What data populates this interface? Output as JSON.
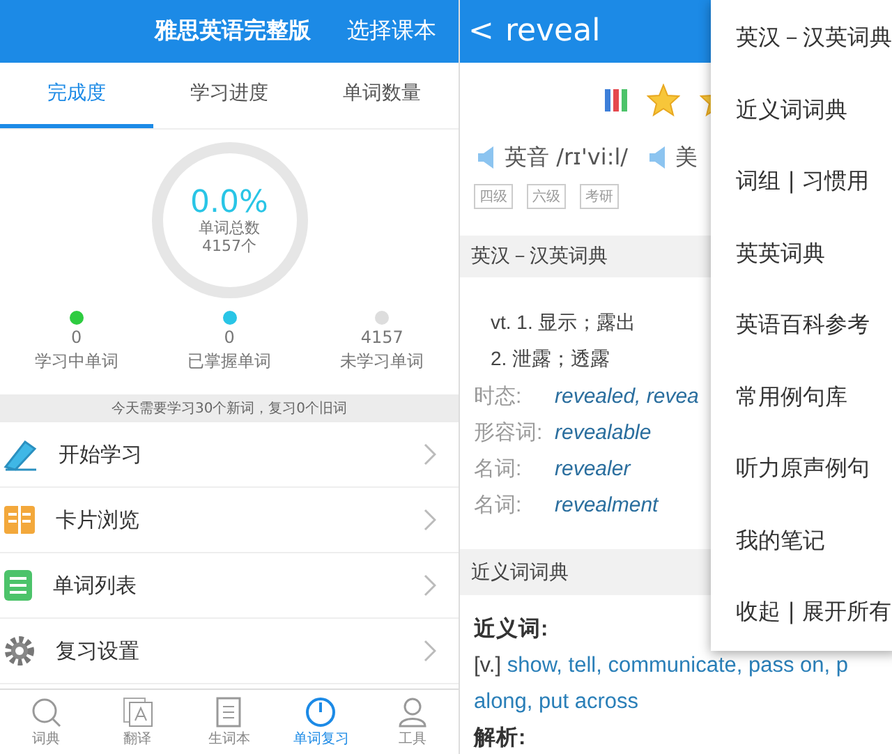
{
  "left": {
    "header": {
      "title": "雅思英语完整版",
      "action": "选择课本"
    },
    "tabs": [
      {
        "label": "完成度",
        "selected": true
      },
      {
        "label": "学习进度",
        "selected": false
      },
      {
        "label": "单词数量",
        "selected": false
      }
    ],
    "progress": {
      "percent": "0.0%",
      "caption": "单词总数",
      "total": "4157个"
    },
    "stats": [
      {
        "count": "0",
        "label": "学习中单词",
        "color": "#2ecc40"
      },
      {
        "count": "0",
        "label": "已掌握单词",
        "color": "#29c5e6"
      },
      {
        "count": "4157",
        "label": "未学习单词",
        "color": "#dddddd"
      }
    ],
    "banner": "今天需要学习30个新词，复习0个旧词",
    "menu": [
      {
        "label": "开始学习",
        "kind": "pen"
      },
      {
        "label": "卡片浏览",
        "kind": "cards"
      },
      {
        "label": "单词列表",
        "kind": "list"
      },
      {
        "label": "复习设置",
        "kind": "gear"
      }
    ],
    "nav": [
      {
        "label": "词典",
        "kind": "search",
        "selected": false
      },
      {
        "label": "翻译",
        "kind": "translate",
        "selected": false
      },
      {
        "label": "生词本",
        "kind": "note",
        "selected": false
      },
      {
        "label": "单词复习",
        "kind": "clock",
        "selected": true
      },
      {
        "label": "工具",
        "kind": "person",
        "selected": false
      }
    ]
  },
  "right": {
    "header": {
      "back": "<",
      "word": "reveal"
    },
    "pron": [
      {
        "label": "英音 /rɪ'vi:l/"
      },
      {
        "label": "美"
      }
    ],
    "tags": [
      "四级",
      "六级",
      "考研"
    ],
    "sections": [
      {
        "title": "英汉－汉英词典",
        "lines": [
          "vt. 1. 显示；露出",
          "2. 泄露；透露"
        ],
        "forms": [
          {
            "name": "时态:",
            "value": "revealed, revea"
          },
          {
            "name": "形容词:",
            "value": "revealable"
          },
          {
            "name": "名词:",
            "value": "revealer"
          },
          {
            "name": "名词:",
            "value": "revealment"
          }
        ]
      },
      {
        "title": "近义词词典",
        "heading": "近义词:",
        "tag": "[v.]",
        "words": "show, tell, communicate, pass on, p",
        "words2": "along, put across",
        "next": "解析:"
      }
    ],
    "popup": [
      "英汉－汉英词典",
      "近义词词典",
      "词组 | 习惯用",
      "英英词典",
      "英语百科参考",
      "常用例句库",
      "听力原声例句",
      "我的笔记",
      "收起 | 展开所有"
    ]
  }
}
